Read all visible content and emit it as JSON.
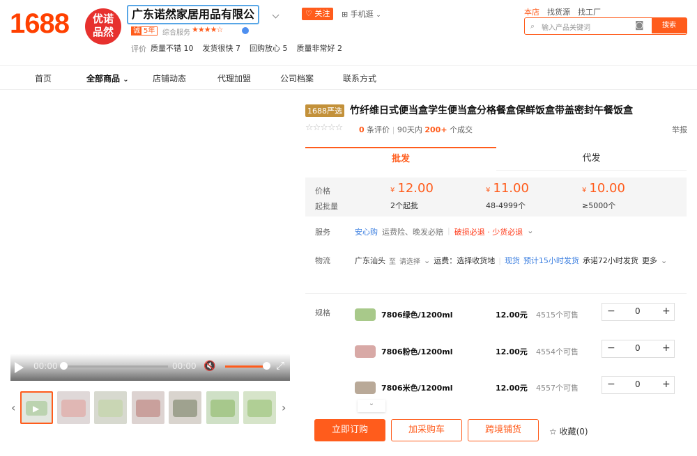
{
  "header": {
    "brand": "1688",
    "shop_logo_line1": "优诺",
    "shop_logo_line2": "品然",
    "shop_name": "广东诺然家居用品有限公",
    "follow_label": "关注",
    "mobile_label": "手机逛",
    "badge_prefix": "诚",
    "badge_years": "5年",
    "service_label": "综合服务",
    "service_stars": "★★★★☆",
    "eval_label": "评价",
    "evals": [
      "质量不错 10",
      "发货很快 7",
      "回购放心 5",
      "质量非常好 2"
    ],
    "scope_tabs": [
      "本店",
      "找货源",
      "找工厂"
    ],
    "search_placeholder": "输入产品关键词",
    "search_button": "搜索"
  },
  "nav": {
    "items": [
      "首页",
      "全部商品",
      "店铺动态",
      "代理加盟",
      "公司档案",
      "联系方式"
    ]
  },
  "video": {
    "current_time": "00:00",
    "duration": "00:00"
  },
  "product": {
    "tag": "1688严选",
    "title": "竹纤维日式便当盒学生便当盒分格餐盒保鲜饭盒带盖密封午餐饭盒",
    "rating_stars": "☆☆☆☆☆",
    "review_count": "0",
    "review_suffix": "条评价",
    "sales_prefix": "90天内",
    "sales_count": "200+",
    "sales_suffix": "个成交",
    "report_label": "举报"
  },
  "tabs": [
    "批发",
    "代发"
  ],
  "pricing": {
    "price_label": "价格",
    "moq_label": "起批量",
    "currency": "¥",
    "tiers": [
      {
        "price": "12.00",
        "qty": "2个起批"
      },
      {
        "price": "11.00",
        "qty": "48-4999个"
      },
      {
        "price": "10.00",
        "qty": "≥5000个"
      }
    ]
  },
  "service": {
    "label": "服务",
    "trust": "安心购",
    "items": "运费险、晚发必赔",
    "guarantees": "破损必退 · 少货必退"
  },
  "logistics": {
    "label": "物流",
    "origin": "广东汕头",
    "to": "至",
    "dest_placeholder": "请选择",
    "freight": "运费：选择收货地",
    "stock_tag": "现货",
    "ship_estimate": "预计15小时发货",
    "promise": "承诺72小时发货",
    "more": "更多"
  },
  "specs": {
    "label": "规格",
    "items": [
      {
        "name": "7806绿色/1200ml",
        "price": "12.00元",
        "stock": "4515个可售",
        "qty": "0",
        "color": "#a8c98a"
      },
      {
        "name": "7806粉色/1200ml",
        "price": "12.00元",
        "stock": "4554个可售",
        "qty": "0",
        "color": "#d8a9a6"
      },
      {
        "name": "7806米色/1200ml",
        "price": "12.00元",
        "stock": "4557个可售",
        "qty": "0",
        "color": "#b9a998"
      }
    ]
  },
  "actions": {
    "buy": "立即订购",
    "cart": "加采购车",
    "cross_border": "跨境铺货",
    "favorite": "收藏(0)"
  },
  "colors": {
    "accent": "#ff5c1c",
    "brand": "#ff4000",
    "trust_blue": "#3c7fe0"
  },
  "thumbnails": [
    "#e3e7e0",
    "#dfd8d8",
    "#d7d9cf",
    "#ddd3d1",
    "#d9d4ce",
    "#cfe0c6",
    "#d6e4c9"
  ]
}
